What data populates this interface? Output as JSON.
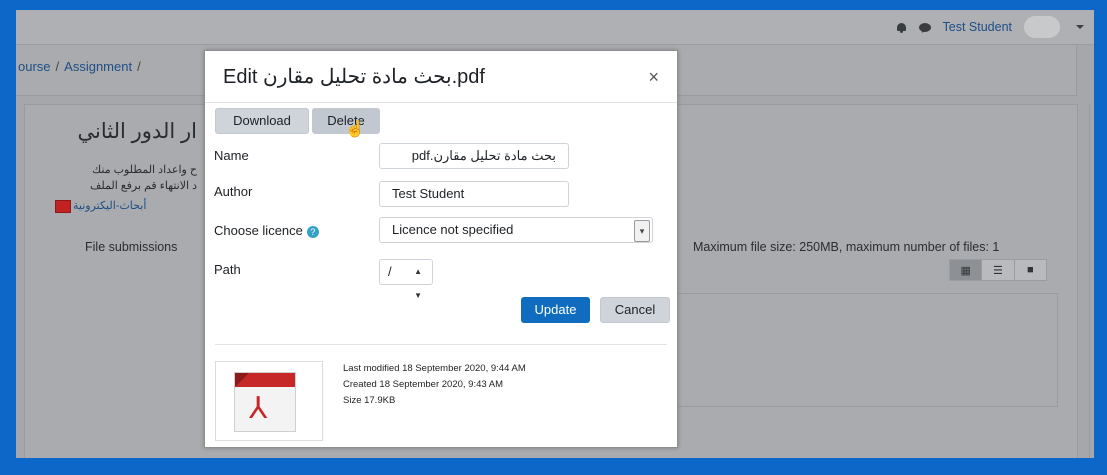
{
  "navbar": {
    "user_name": "Test Student"
  },
  "breadcrumb": {
    "course": "ourse",
    "assignment": "Assignment",
    "partial": "/"
  },
  "page": {
    "heading_partial": "ار الدور الثاني",
    "desc_line1": "ح واعداد المطلوب منك",
    "desc_line2": "د الانتهاء قم برفع الملف",
    "attachment_link": "أبحاث-اليكترونية",
    "file_submissions_label": "File submissions",
    "max_file_size": "Maximum file size: 250MB, maximum number of files: 1"
  },
  "modal": {
    "title": "Edit بحث مادة تحليل مقارن.pdf",
    "download_label": "Download",
    "delete_label": "Delete",
    "name_label": "Name",
    "name_value": "بحث مادة تحليل مقارن.pdf",
    "author_label": "Author",
    "author_value": "Test Student",
    "licence_label": "Choose licence",
    "licence_value": "Licence not specified",
    "path_label": "Path",
    "path_value": "/",
    "update_label": "Update",
    "cancel_label": "Cancel",
    "last_modified": "Last modified  18 September 2020, 9:44 AM",
    "created": "Created  18 September 2020, 9:43 AM",
    "size": "Size  17.9KB"
  },
  "colors": {
    "frame_border": "#0d67c9",
    "primary_button": "#0f6cbf",
    "link": "#1f4f86",
    "pdf_red": "#c62828"
  },
  "icons": [
    "bell-icon",
    "chat-icon",
    "caret-down-icon",
    "help-icon",
    "close-icon",
    "pdf-file-icon",
    "grid-view-icon",
    "list-view-icon",
    "folder-view-icon",
    "hand-cursor-icon"
  ]
}
